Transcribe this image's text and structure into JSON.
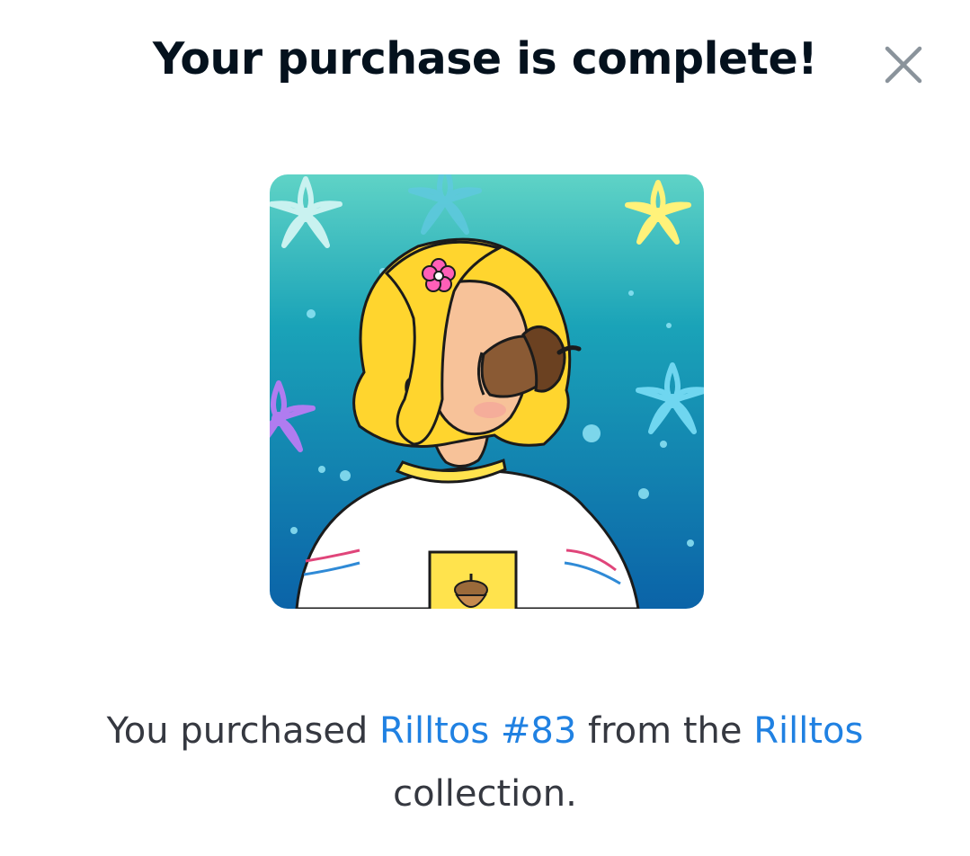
{
  "modal": {
    "title": "Your purchase is complete!",
    "close_icon": "close-icon"
  },
  "nft": {
    "image_alt": "Rilltos #83 artwork",
    "icon": "nft-artwork-image"
  },
  "message": {
    "prefix": "You purchased ",
    "item_link": "Rilltos #83",
    "middle": " from the ",
    "collection_link": "Rilltos",
    "suffix_line2": "collection."
  },
  "colors": {
    "title": "#04111d",
    "body_text": "#353840",
    "link": "#2081e2",
    "close_icon": "#8a939b"
  }
}
